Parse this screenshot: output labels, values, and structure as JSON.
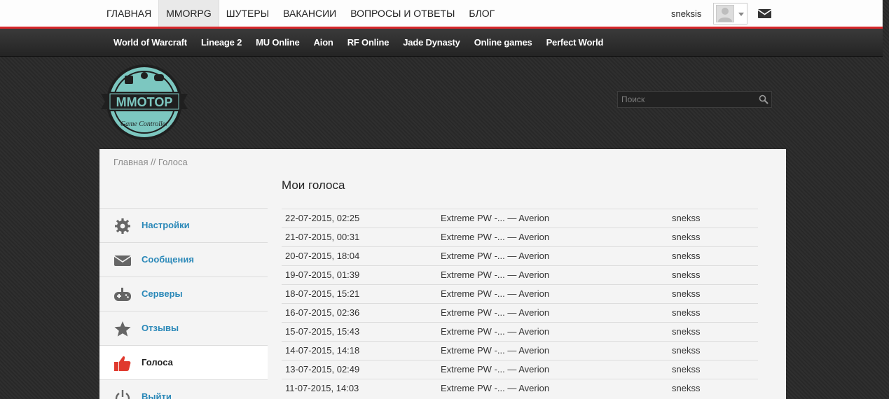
{
  "topnav": {
    "items": [
      {
        "label": "ГЛАВНАЯ",
        "active": false
      },
      {
        "label": "MMORPG",
        "active": true
      },
      {
        "label": "ШУТЕРЫ",
        "active": false
      },
      {
        "label": "ВАКАНСИИ",
        "active": false
      },
      {
        "label": "ВОПРОСЫ И ОТВЕТЫ",
        "active": false
      },
      {
        "label": "БЛОГ",
        "active": false
      }
    ],
    "username": "sneksis"
  },
  "subnav": {
    "items": [
      "World of Warcraft",
      "Lineage 2",
      "MU Online",
      "Aion",
      "RF Online",
      "Jade Dynasty",
      "Online games",
      "Perfect World"
    ]
  },
  "logo": {
    "text": "MMOTOP",
    "tagline": "Game Controller"
  },
  "search": {
    "placeholder": "Поиск"
  },
  "breadcrumb": "Главная // Голоса",
  "sidebar": {
    "items": [
      {
        "label": "Настройки",
        "icon": "gear-icon"
      },
      {
        "label": "Сообщения",
        "icon": "envelope-icon"
      },
      {
        "label": "Серверы",
        "icon": "gamepad-icon"
      },
      {
        "label": "Отзывы",
        "icon": "star-icon"
      },
      {
        "label": "Голоса",
        "icon": "thumbs-up-icon",
        "active": true
      },
      {
        "label": "Выйти",
        "icon": "power-icon"
      }
    ]
  },
  "content": {
    "title": "Мои голоса",
    "votes": [
      {
        "date": "22-07-2015, 02:25",
        "server": "Extreme PW -... — Averion",
        "user": "snekss"
      },
      {
        "date": "21-07-2015, 00:31",
        "server": "Extreme PW -... — Averion",
        "user": "snekss"
      },
      {
        "date": "20-07-2015, 18:04",
        "server": "Extreme PW -... — Averion",
        "user": "snekss"
      },
      {
        "date": "19-07-2015, 01:39",
        "server": "Extreme PW -... — Averion",
        "user": "snekss"
      },
      {
        "date": "18-07-2015, 15:21",
        "server": "Extreme PW -... — Averion",
        "user": "snekss"
      },
      {
        "date": "16-07-2015, 02:36",
        "server": "Extreme PW -... — Averion",
        "user": "snekss"
      },
      {
        "date": "15-07-2015, 15:43",
        "server": "Extreme PW -... — Averion",
        "user": "snekss"
      },
      {
        "date": "14-07-2015, 14:18",
        "server": "Extreme PW -... — Averion",
        "user": "snekss"
      },
      {
        "date": "13-07-2015, 02:49",
        "server": "Extreme PW -... — Averion",
        "user": "snekss"
      },
      {
        "date": "11-07-2015, 14:03",
        "server": "Extreme PW -... — Averion",
        "user": "snekss"
      }
    ]
  },
  "colors": {
    "accent_red": "#d8272b",
    "link_blue": "#2a88b8",
    "logo_teal": "#7cc7c0"
  }
}
